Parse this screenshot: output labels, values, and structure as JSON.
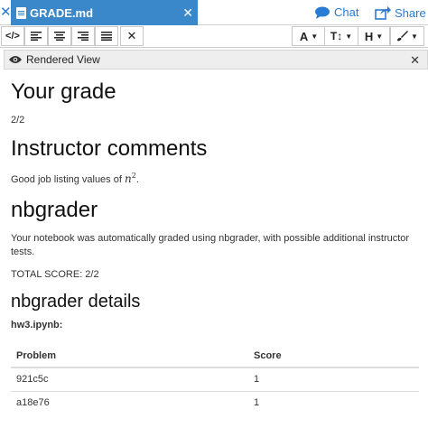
{
  "tabs": {
    "active_title": "GRADE.md",
    "chat_label": "Chat",
    "share_label": "Share"
  },
  "toolbar": {
    "code_label": "</>",
    "font_label": "A",
    "size_label": "T↕",
    "heading_label": "H"
  },
  "panel": {
    "title": "Rendered View"
  },
  "doc": {
    "h_grade": "Your grade",
    "grade_value": "2/2",
    "h_comments": "Instructor comments",
    "comment_prefix": "Good job listing values of",
    "comment_var": "n",
    "comment_exp": "2",
    "comment_suffix": ".",
    "h_nbgrader": "nbgrader",
    "nbgrader_text": "Your notebook was automatically graded using nbgrader, with possible additional instructor tests.",
    "total_score": "TOTAL SCORE: 2/2",
    "h_details": "nbgrader details",
    "notebook_file": "hw3.ipynb:",
    "table": {
      "headers": [
        "Problem",
        "Score"
      ],
      "rows": [
        [
          "921c5c",
          "1"
        ],
        [
          "a18e76",
          "1"
        ]
      ]
    }
  },
  "colors": {
    "accent": "#3a87c9",
    "link": "#2a7bd3"
  }
}
